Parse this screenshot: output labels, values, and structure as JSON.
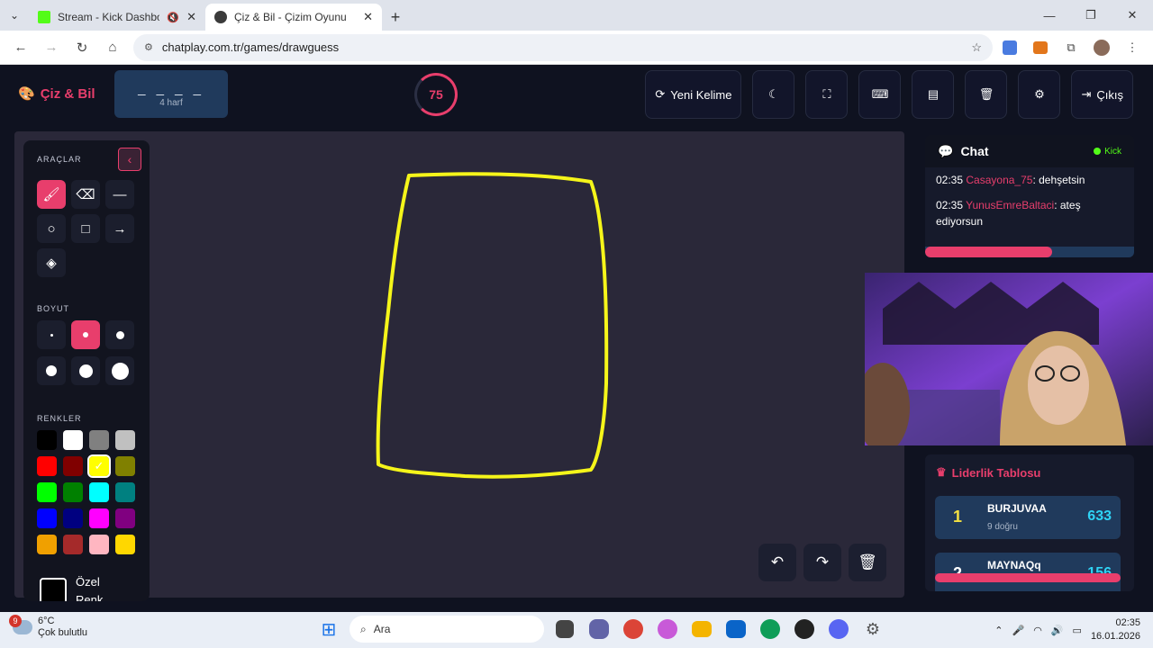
{
  "browser": {
    "tabs": [
      {
        "title": "Stream - Kick Dashboard",
        "active": false,
        "favicon_color": "#53fc18"
      },
      {
        "title": "Çiz & Bil - Çizim Oyunu",
        "active": true,
        "favicon_color": "#3b3b3b"
      }
    ],
    "url": "chatplay.com.tr/games/drawguess"
  },
  "app": {
    "logo": "Çiz & Bil",
    "word_blanks": "_ _ _ _",
    "word_hint": "4 harf",
    "timer": "75",
    "buttons": {
      "new_word": "Yeni Kelime",
      "exit": "Çıkış"
    }
  },
  "tools": {
    "section_tools": "ARAÇLAR",
    "section_size": "BOYUT",
    "section_colors": "RENKLER",
    "custom_color": "Özel Renk"
  },
  "colors": {
    "accent": "#e83e6c",
    "stroke": "#f5f51a",
    "palette": [
      "#000000",
      "#ffffff",
      "#808080",
      "#c0c0c0",
      "#ff0000",
      "#800000",
      "#ffff00",
      "#808000",
      "#00ff00",
      "#008000",
      "#00ffff",
      "#008080",
      "#0000ff",
      "#000080",
      "#ff00ff",
      "#800080",
      "#f0a000",
      "#a52a2a",
      "#ffb6c1",
      "#ffd700"
    ]
  },
  "chat": {
    "title": "Chat",
    "source": "Kick",
    "messages": [
      {
        "time": "02:35",
        "user": "Casayona_75",
        "text": ": dehşetsin"
      },
      {
        "time": "02:35",
        "user": "YunusEmreBaltaci",
        "text": ": ateş ediyorsun"
      }
    ]
  },
  "leaderboard": {
    "title": "Liderlik Tablosu",
    "rows": [
      {
        "rank": "1",
        "name": "BURJUVAA",
        "sub": "9 doğru",
        "score": "633"
      },
      {
        "rank": "2",
        "name": "MAYNAQq",
        "sub": "",
        "score": "156"
      }
    ]
  },
  "taskbar": {
    "badge": "9",
    "temp": "6°C",
    "weather": "Çok bulutlu",
    "search": "Ara",
    "time": "02:35",
    "date": "16.01.2026"
  }
}
